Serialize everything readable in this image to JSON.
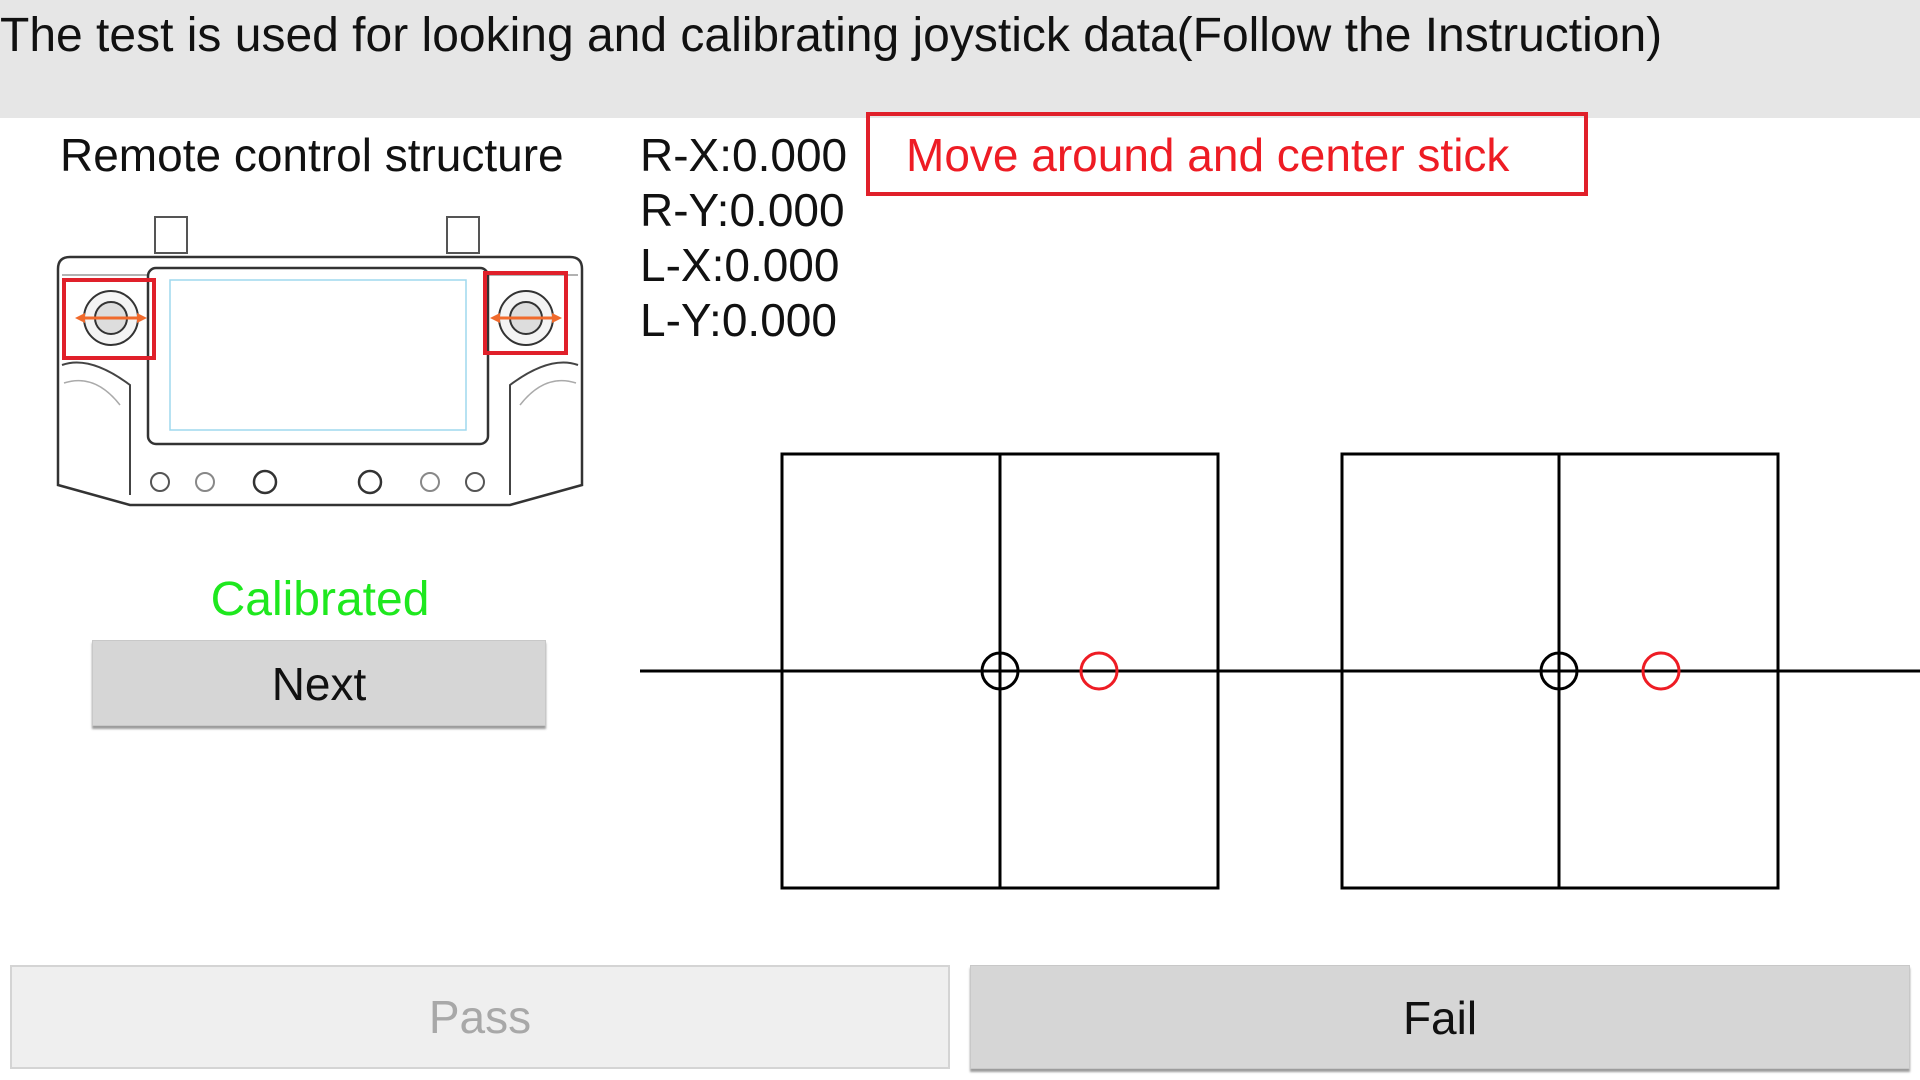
{
  "header": {
    "title": "The test is used for looking and calibrating joystick data(Follow the Instruction)"
  },
  "left_panel": {
    "section_title": "Remote control structure",
    "image_icon": "remote-controller-diagram",
    "status": "Calibrated",
    "next_label": "Next"
  },
  "readouts": {
    "rx": "R-X:0.000",
    "ry": "R-Y:0.000",
    "lx": "L-X:0.000",
    "ly": "L-Y:0.000"
  },
  "instruction": "Move around and center stick",
  "footer": {
    "pass_label": "Pass",
    "fail_label": "Fail"
  },
  "colors": {
    "accent_red": "#ee1c24",
    "status_green": "#1ee81e",
    "header_bg": "#e6e6e6",
    "button_bg": "#d6d6d6"
  }
}
